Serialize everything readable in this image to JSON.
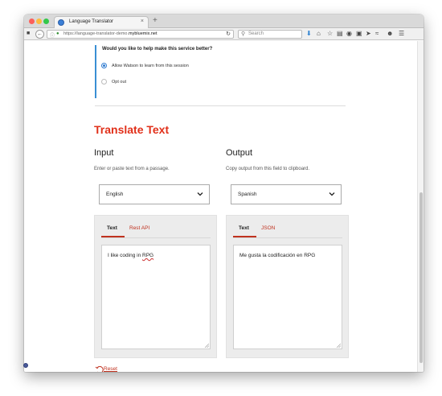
{
  "browser": {
    "tab_title": "Language Translator",
    "tab_close": "×",
    "new_tab": "+",
    "url_prefix": "https://language-translator-demo.",
    "url_domain": "mybluemix.net",
    "search_placeholder": "Search"
  },
  "consent": {
    "title": "Would you like to help make this service better?",
    "options": [
      {
        "label": "Allow Watson to learn from this session",
        "selected": true
      },
      {
        "label": "Opt out",
        "selected": false
      }
    ]
  },
  "heading": "Translate Text",
  "input": {
    "title": "Input",
    "subtitle": "Enter or paste text from a passage.",
    "language": "English",
    "tabs": [
      "Text",
      "Rest API"
    ],
    "active_tab": "Text",
    "text_before": "I like coding in ",
    "text_flagged": "RPG"
  },
  "output": {
    "title": "Output",
    "subtitle": "Copy output from this field to clipboard.",
    "language": "Spanish",
    "tabs": [
      "Text",
      "JSON"
    ],
    "active_tab": "Text",
    "text": "Me gusta la codificación en RPG"
  },
  "reset_label": "Reset",
  "colors": {
    "accent_red": "#e1301a",
    "link_red": "#c0321f",
    "consent_bar": "#3a8fd4"
  }
}
